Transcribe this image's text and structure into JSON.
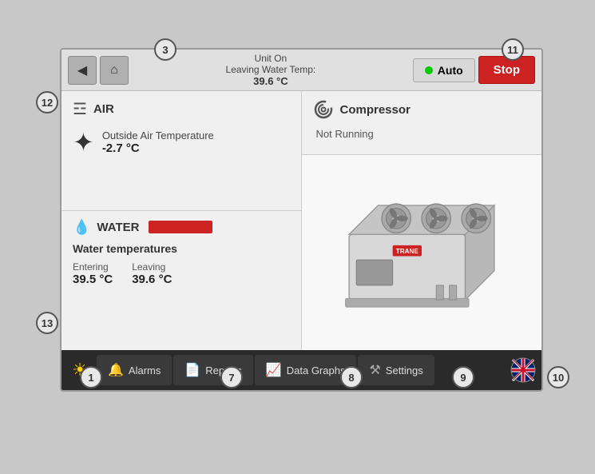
{
  "numbers": {
    "n1": "1",
    "n3": "3",
    "n7": "7",
    "n8": "8",
    "n9": "9",
    "n10": "10",
    "n11": "11",
    "n12": "12",
    "n13": "13"
  },
  "header": {
    "unit_status": "Unit On",
    "leaving_label": "Leaving Water Temp:",
    "leaving_value": "39.6 °C",
    "auto_label": "Auto",
    "stop_label": "Stop"
  },
  "air_panel": {
    "title": "AIR",
    "temp_label": "Outside Air Temperature",
    "temp_value": "-2.7   °C"
  },
  "water_panel": {
    "title": "WATER",
    "temps_title": "Water temperatures",
    "entering_label": "Entering",
    "entering_value": "39.5  °C",
    "leaving_label": "Leaving",
    "leaving_value": "39.6  °C"
  },
  "compressor_panel": {
    "title": "Compressor",
    "status": "Not Running"
  },
  "nav": {
    "alarms_label": "Alarms",
    "reports_label": "Reports",
    "data_graphs_label": "Data Graphs",
    "settings_label": "Settings"
  }
}
